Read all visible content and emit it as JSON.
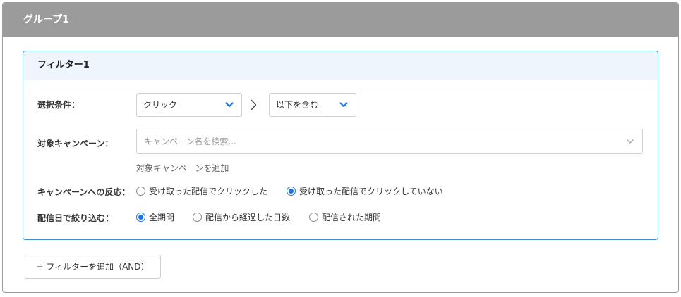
{
  "group": {
    "title": "グループ1"
  },
  "filter": {
    "title": "フィルター1",
    "condition": {
      "label": "選択条件：",
      "event_select": "クリック",
      "operator_select": "以下を含む"
    },
    "campaign": {
      "label": "対象キャンペーン：",
      "search_placeholder": "キャンペーン名を検索...",
      "add_link": "対象キャンペーンを追加"
    },
    "reaction": {
      "label": "キャンペーンへの反応：",
      "options": [
        {
          "label": "受け取った配信でクリックした",
          "selected": false
        },
        {
          "label": "受け取った配信でクリックしていない",
          "selected": true
        }
      ]
    },
    "date": {
      "label": "配信日で絞り込む：",
      "options": [
        {
          "label": "全期間",
          "selected": true
        },
        {
          "label": "配信から経過した日数",
          "selected": false
        },
        {
          "label": "配信された期間",
          "selected": false
        }
      ]
    }
  },
  "add_filter_button": "+ フィルターを追加（AND）",
  "colors": {
    "header_gray": "#9b9b9b",
    "accent_blue": "#1a73e8",
    "filter_border": "#3b8fd9"
  },
  "icons": {
    "select_chevron": "chevron-down-icon",
    "separator": "chevron-right-icon"
  }
}
